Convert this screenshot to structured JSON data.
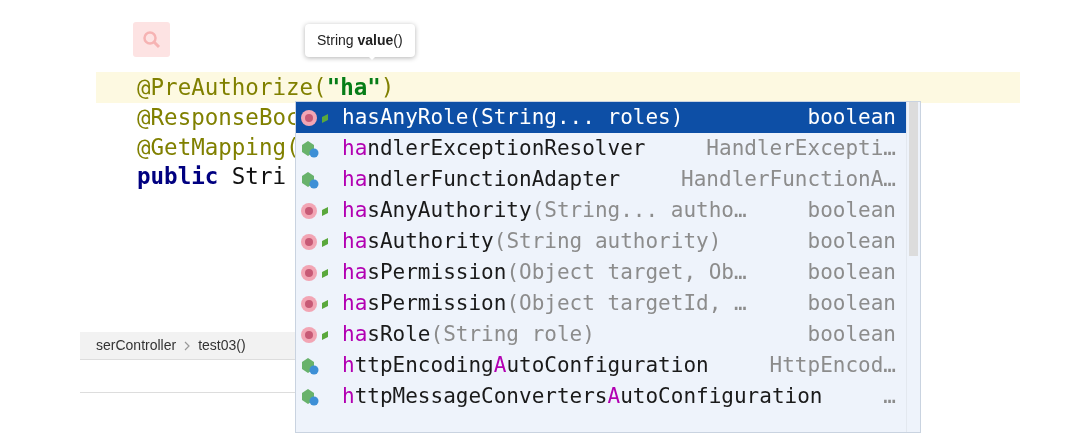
{
  "tooltip": {
    "text": "String **value**()"
  },
  "code_lines": [
    {
      "current": true,
      "tokens": [
        {
          "kind": "annotation",
          "text": "@PreAuthorize("
        },
        {
          "kind": "string",
          "text": "\"ha\""
        },
        {
          "kind": "annotation",
          "text": ")"
        }
      ]
    },
    {
      "current": false,
      "tokens": [
        {
          "kind": "annotation",
          "text": "@ResponseBoc"
        }
      ]
    },
    {
      "current": false,
      "tokens": [
        {
          "kind": "annotation",
          "text": "@GetMapping("
        }
      ]
    },
    {
      "current": false,
      "tokens": [
        {
          "kind": "keyword",
          "text": "public"
        },
        {
          "kind": "plain",
          "text": " Stri"
        }
      ]
    }
  ],
  "breadcrumb": [
    "serController",
    "test03()"
  ],
  "completion": {
    "rows": [
      {
        "kind": "method",
        "selected": true,
        "name": [
          {
            "text": "hasAnyRole"
          }
        ],
        "params": "(String... roles)",
        "type": "boolean"
      },
      {
        "kind": "class",
        "selected": false,
        "name": [
          {
            "text": "ha",
            "match": true
          },
          {
            "text": "ndlerExceptionResolver",
            "match": false
          }
        ],
        "type": "HandlerExcepti…"
      },
      {
        "kind": "class",
        "selected": false,
        "name": [
          {
            "text": "ha",
            "match": true
          },
          {
            "text": "ndlerFunctionAdapter",
            "match": false
          }
        ],
        "type": "HandlerFunctionA…"
      },
      {
        "kind": "method",
        "selected": false,
        "name": [
          {
            "text": "ha",
            "match": true
          },
          {
            "text": "sAnyAuthority",
            "match": false
          }
        ],
        "params": "(String... autho…",
        "type": "boolean"
      },
      {
        "kind": "method",
        "selected": false,
        "name": [
          {
            "text": "ha",
            "match": true
          },
          {
            "text": "sAuthority",
            "match": false
          }
        ],
        "params": "(String authority)",
        "type": "boolean"
      },
      {
        "kind": "method",
        "selected": false,
        "name": [
          {
            "text": "ha",
            "match": true
          },
          {
            "text": "sPermission",
            "match": false
          }
        ],
        "params": "(Object target, Ob…",
        "type": "boolean"
      },
      {
        "kind": "method",
        "selected": false,
        "name": [
          {
            "text": "ha",
            "match": true
          },
          {
            "text": "sPermission",
            "match": false
          }
        ],
        "params": "(Object targetId, …",
        "type": "boolean"
      },
      {
        "kind": "method",
        "selected": false,
        "name": [
          {
            "text": "ha",
            "match": true
          },
          {
            "text": "sRole",
            "match": false
          }
        ],
        "params": "(String role)",
        "type": "boolean"
      },
      {
        "kind": "class",
        "selected": false,
        "name": [
          {
            "text": "h",
            "match": true
          },
          {
            "text": "ttpEncoding",
            "match": false
          },
          {
            "text": "A",
            "match": true
          },
          {
            "text": "utoConfiguration",
            "match": false
          }
        ],
        "type": "HttpEncod…"
      },
      {
        "kind": "class",
        "selected": false,
        "name": [
          {
            "text": "h",
            "match": true
          },
          {
            "text": "ttpMessageConverters",
            "match": false
          },
          {
            "text": "A",
            "match": true
          },
          {
            "text": "utoConfiguration",
            "match": false
          }
        ],
        "type": "…"
      }
    ]
  }
}
